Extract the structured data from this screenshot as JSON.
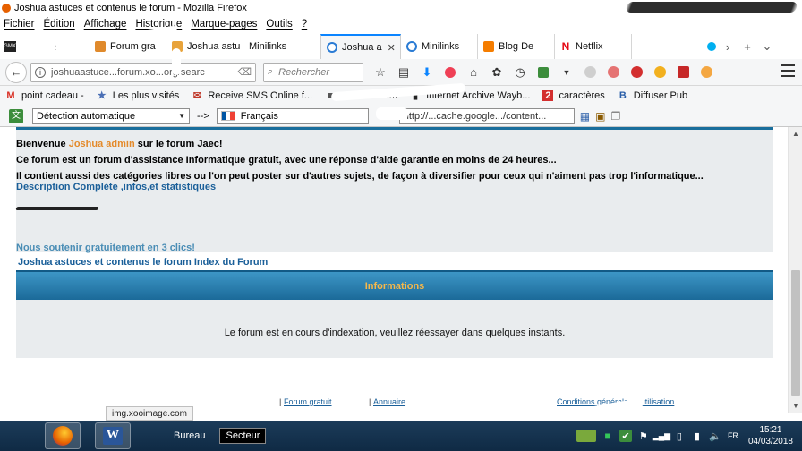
{
  "window": {
    "title": "Joshua astuces et contenus le forum - Mozilla Firefox"
  },
  "menu": [
    "Fichier",
    "Édition",
    "Affichage",
    "Historique",
    "Marque-pages",
    "Outils",
    "?"
  ],
  "tabs": [
    {
      "label": "Forum gra",
      "icon_color": "#e08a2c"
    },
    {
      "label": "Joshua astu",
      "icon_color": "#e8a33b"
    },
    {
      "label": "Minilinks",
      "icon_color": "#ffffff"
    },
    {
      "label": "Joshua a",
      "icon_color": "#2a7bd4",
      "active": true
    },
    {
      "label": "Minilinks",
      "icon_color": "#2a7bd4"
    },
    {
      "label": "Blog De",
      "icon_color": "#f57d00"
    },
    {
      "label": "Netflix",
      "icon_color": "#e50914"
    }
  ],
  "navbar": {
    "url": "joshuaastuce...forum.xo...org/searc",
    "search_placeholder": "Rechercher"
  },
  "bookmarks": [
    {
      "label": "point cadeau -",
      "icon": "M",
      "color": "#d93025"
    },
    {
      "label": "Les plus visités",
      "icon": "★",
      "color": "#4a6fb5"
    },
    {
      "label": "Receive SMS Online f...",
      "icon": "✉",
      "color": "#c0392b"
    },
    {
      "label": "Boost Forum",
      "icon": "■",
      "color": "#555555"
    },
    {
      "label": "Internet Archive Wayb...",
      "icon": "▮",
      "color": "#222222"
    },
    {
      "label": "caractères",
      "icon": "2",
      "color": "#d32f2f"
    },
    {
      "label": "Diffuser Pub",
      "icon": "B",
      "color": "#2a5ea8"
    }
  ],
  "translate": {
    "source": "Détection automatique",
    "arrow": "-->",
    "target": "Français",
    "url_partial": "http://...cache.google.../content..."
  },
  "page": {
    "welcome_prefix": "Bienvenue",
    "username": "Joshua admin",
    "welcome_suffix": "sur le forum Jaec!",
    "line2": "Ce forum est un forum d'assistance Informatique gratuit, avec une réponse d'aide garantie en moins de 24 heures...",
    "line3": "Il contient aussi des catégories libres ou l'on peut poster sur d'autres sujets, de façon à diversifier pour ceux qui n'aiment pas trop l'informatique...",
    "description_link": "Description Complète ,infos,et statistiques",
    "support_link": "Nous soutenir gratuitement en 3 clics!",
    "breadcrumb": "Joshua astuces et contenus le forum Index du Forum",
    "info_title": "Informations",
    "info_message": "Le forum est en cours d'indexation, veuillez réessayer dans quelques instants."
  },
  "footer": {
    "forum_gratuit": "Forum gratuit",
    "annuaire": "Annuaire",
    "conditions": "Conditions générales d'utilisation"
  },
  "status_url": "img.xooimage.com",
  "taskbar": {
    "bureau": "Bureau",
    "secteur": "Secteur",
    "time": "15:21",
    "date": "04/03/2018"
  }
}
